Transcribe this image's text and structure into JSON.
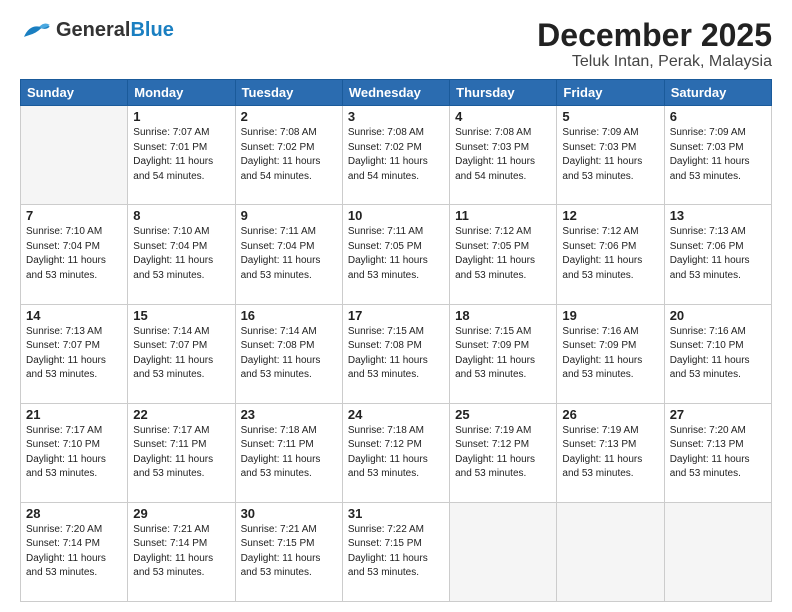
{
  "logo": {
    "part1": "General",
    "part2": "Blue"
  },
  "title": "December 2025",
  "subtitle": "Teluk Intan, Perak, Malaysia",
  "days_of_week": [
    "Sunday",
    "Monday",
    "Tuesday",
    "Wednesday",
    "Thursday",
    "Friday",
    "Saturday"
  ],
  "weeks": [
    [
      {
        "day": "",
        "info": ""
      },
      {
        "day": "1",
        "info": "Sunrise: 7:07 AM\nSunset: 7:01 PM\nDaylight: 11 hours\nand 54 minutes."
      },
      {
        "day": "2",
        "info": "Sunrise: 7:08 AM\nSunset: 7:02 PM\nDaylight: 11 hours\nand 54 minutes."
      },
      {
        "day": "3",
        "info": "Sunrise: 7:08 AM\nSunset: 7:02 PM\nDaylight: 11 hours\nand 54 minutes."
      },
      {
        "day": "4",
        "info": "Sunrise: 7:08 AM\nSunset: 7:03 PM\nDaylight: 11 hours\nand 54 minutes."
      },
      {
        "day": "5",
        "info": "Sunrise: 7:09 AM\nSunset: 7:03 PM\nDaylight: 11 hours\nand 53 minutes."
      },
      {
        "day": "6",
        "info": "Sunrise: 7:09 AM\nSunset: 7:03 PM\nDaylight: 11 hours\nand 53 minutes."
      }
    ],
    [
      {
        "day": "7",
        "info": "Sunrise: 7:10 AM\nSunset: 7:04 PM\nDaylight: 11 hours\nand 53 minutes."
      },
      {
        "day": "8",
        "info": "Sunrise: 7:10 AM\nSunset: 7:04 PM\nDaylight: 11 hours\nand 53 minutes."
      },
      {
        "day": "9",
        "info": "Sunrise: 7:11 AM\nSunset: 7:04 PM\nDaylight: 11 hours\nand 53 minutes."
      },
      {
        "day": "10",
        "info": "Sunrise: 7:11 AM\nSunset: 7:05 PM\nDaylight: 11 hours\nand 53 minutes."
      },
      {
        "day": "11",
        "info": "Sunrise: 7:12 AM\nSunset: 7:05 PM\nDaylight: 11 hours\nand 53 minutes."
      },
      {
        "day": "12",
        "info": "Sunrise: 7:12 AM\nSunset: 7:06 PM\nDaylight: 11 hours\nand 53 minutes."
      },
      {
        "day": "13",
        "info": "Sunrise: 7:13 AM\nSunset: 7:06 PM\nDaylight: 11 hours\nand 53 minutes."
      }
    ],
    [
      {
        "day": "14",
        "info": "Sunrise: 7:13 AM\nSunset: 7:07 PM\nDaylight: 11 hours\nand 53 minutes."
      },
      {
        "day": "15",
        "info": "Sunrise: 7:14 AM\nSunset: 7:07 PM\nDaylight: 11 hours\nand 53 minutes."
      },
      {
        "day": "16",
        "info": "Sunrise: 7:14 AM\nSunset: 7:08 PM\nDaylight: 11 hours\nand 53 minutes."
      },
      {
        "day": "17",
        "info": "Sunrise: 7:15 AM\nSunset: 7:08 PM\nDaylight: 11 hours\nand 53 minutes."
      },
      {
        "day": "18",
        "info": "Sunrise: 7:15 AM\nSunset: 7:09 PM\nDaylight: 11 hours\nand 53 minutes."
      },
      {
        "day": "19",
        "info": "Sunrise: 7:16 AM\nSunset: 7:09 PM\nDaylight: 11 hours\nand 53 minutes."
      },
      {
        "day": "20",
        "info": "Sunrise: 7:16 AM\nSunset: 7:10 PM\nDaylight: 11 hours\nand 53 minutes."
      }
    ],
    [
      {
        "day": "21",
        "info": "Sunrise: 7:17 AM\nSunset: 7:10 PM\nDaylight: 11 hours\nand 53 minutes."
      },
      {
        "day": "22",
        "info": "Sunrise: 7:17 AM\nSunset: 7:11 PM\nDaylight: 11 hours\nand 53 minutes."
      },
      {
        "day": "23",
        "info": "Sunrise: 7:18 AM\nSunset: 7:11 PM\nDaylight: 11 hours\nand 53 minutes."
      },
      {
        "day": "24",
        "info": "Sunrise: 7:18 AM\nSunset: 7:12 PM\nDaylight: 11 hours\nand 53 minutes."
      },
      {
        "day": "25",
        "info": "Sunrise: 7:19 AM\nSunset: 7:12 PM\nDaylight: 11 hours\nand 53 minutes."
      },
      {
        "day": "26",
        "info": "Sunrise: 7:19 AM\nSunset: 7:13 PM\nDaylight: 11 hours\nand 53 minutes."
      },
      {
        "day": "27",
        "info": "Sunrise: 7:20 AM\nSunset: 7:13 PM\nDaylight: 11 hours\nand 53 minutes."
      }
    ],
    [
      {
        "day": "28",
        "info": "Sunrise: 7:20 AM\nSunset: 7:14 PM\nDaylight: 11 hours\nand 53 minutes."
      },
      {
        "day": "29",
        "info": "Sunrise: 7:21 AM\nSunset: 7:14 PM\nDaylight: 11 hours\nand 53 minutes."
      },
      {
        "day": "30",
        "info": "Sunrise: 7:21 AM\nSunset: 7:15 PM\nDaylight: 11 hours\nand 53 minutes."
      },
      {
        "day": "31",
        "info": "Sunrise: 7:22 AM\nSunset: 7:15 PM\nDaylight: 11 hours\nand 53 minutes."
      },
      {
        "day": "",
        "info": ""
      },
      {
        "day": "",
        "info": ""
      },
      {
        "day": "",
        "info": ""
      }
    ]
  ]
}
